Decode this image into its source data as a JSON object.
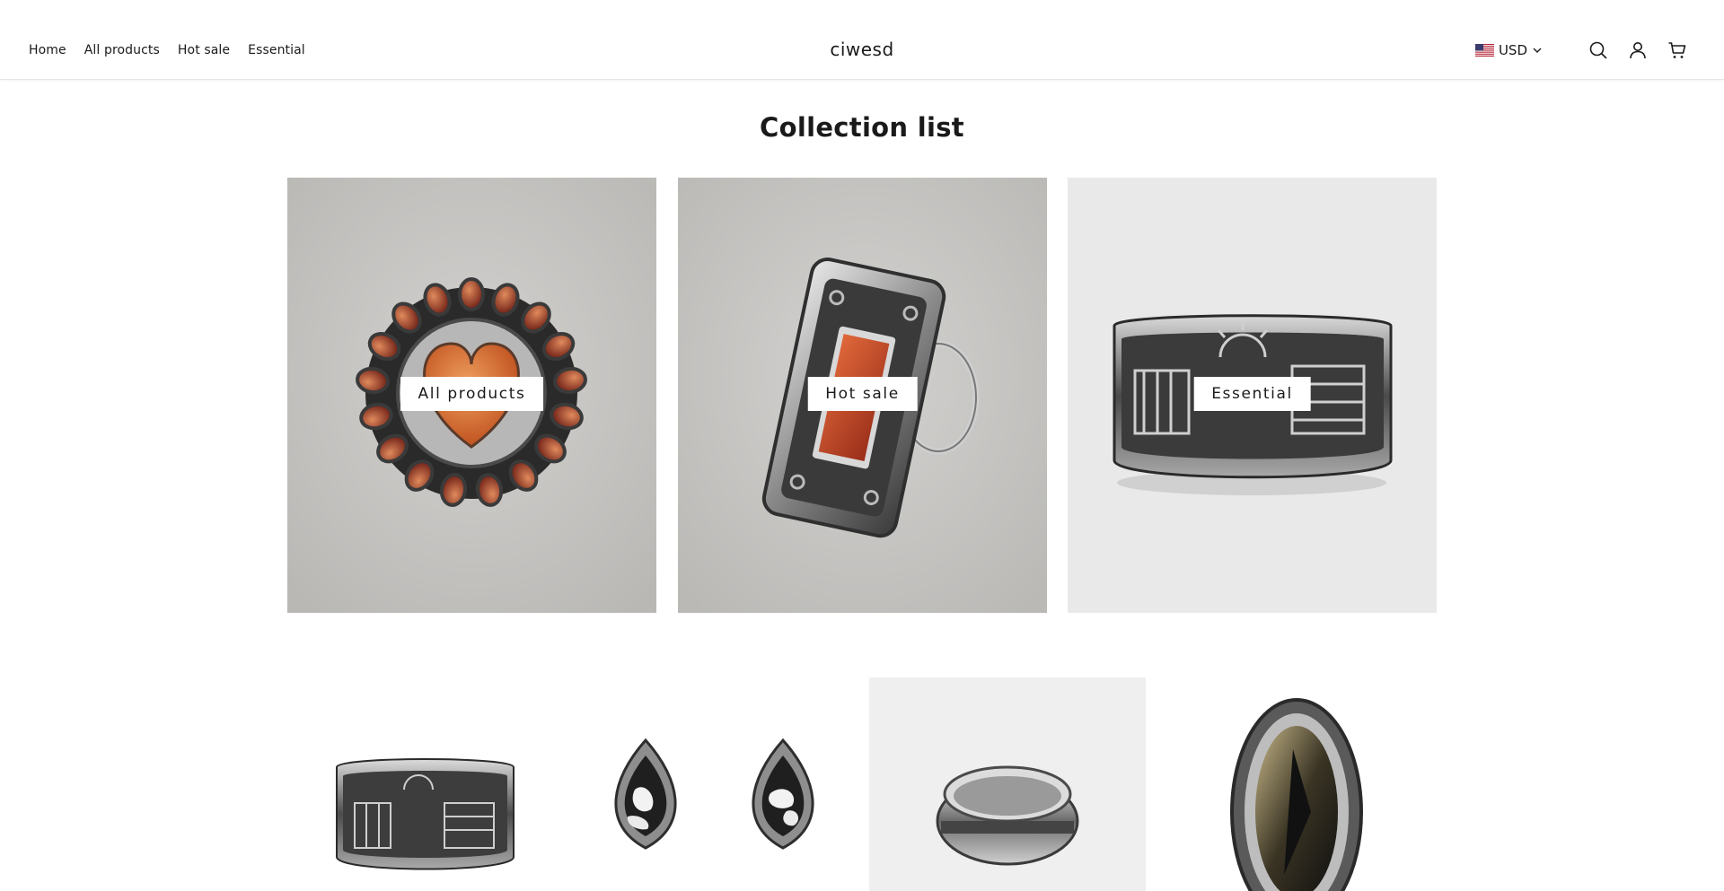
{
  "header": {
    "nav": [
      "Home",
      "All products",
      "Hot sale",
      "Essential"
    ],
    "logo": "ciwesd",
    "currency": "USD",
    "icons": [
      "us-flag-icon",
      "chevron-down-icon",
      "search-icon",
      "account-icon",
      "cart-icon"
    ]
  },
  "collection": {
    "title": "Collection list",
    "cards": [
      {
        "label": "All products",
        "image": "heart-cluster-ring"
      },
      {
        "label": "Hot sale",
        "image": "rectangle-stone-ring"
      },
      {
        "label": "Essential",
        "image": "storyteller-band-ring"
      }
    ]
  },
  "products": [
    {
      "image": "storyteller-band-ring"
    },
    {
      "image": "teardrop-earrings"
    },
    {
      "image": "silver-spinner-band"
    },
    {
      "image": "oval-stone-ring"
    }
  ],
  "colors": {
    "text": "#1a1a1a",
    "header_border": "#e6e6e6",
    "stone_bg": "#c9c8c6",
    "label_bg": "#ffffff"
  }
}
